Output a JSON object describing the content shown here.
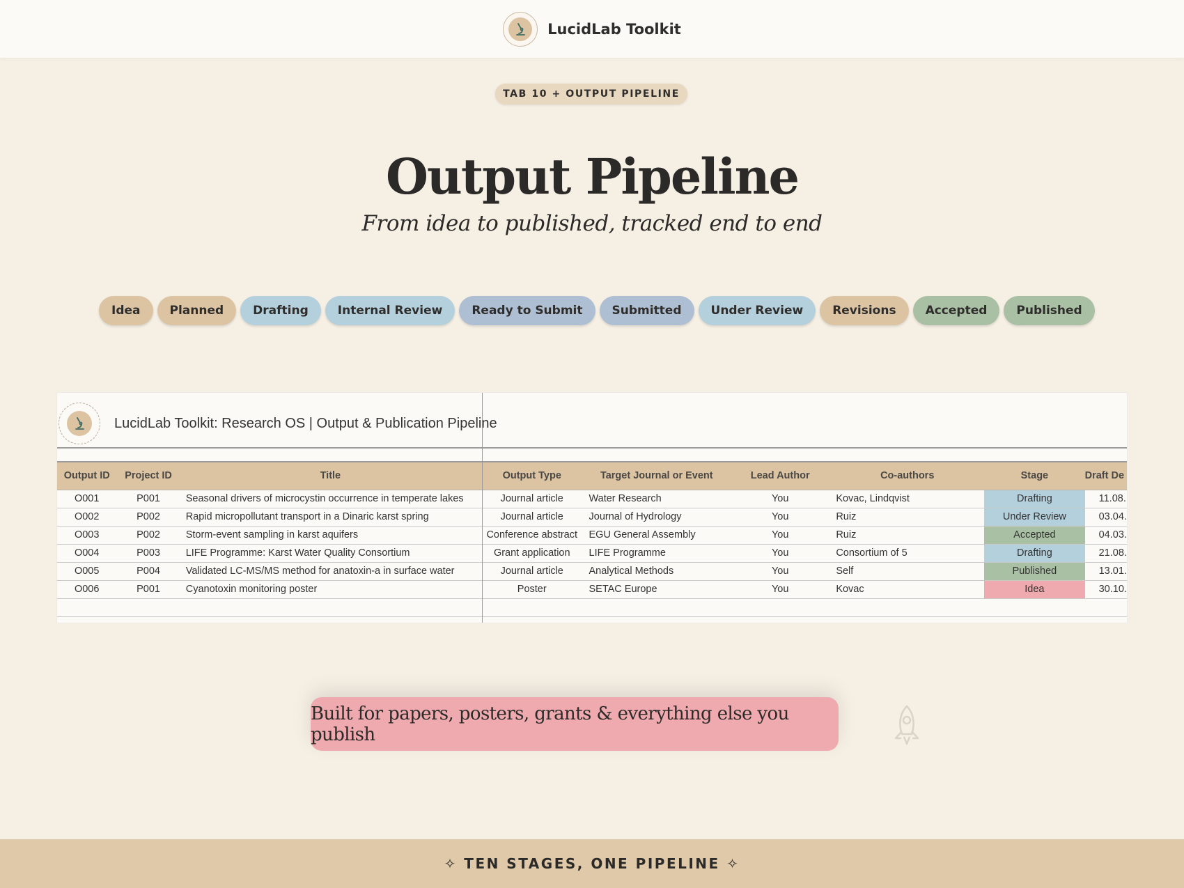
{
  "header": {
    "brand": "LucidLab Toolkit",
    "logo_icon": "microscope-icon"
  },
  "tab_pill": "TAB 10 + OUTPUT PIPELINE",
  "title": "Output Pipeline",
  "subtitle": "From idea to published, tracked end to end",
  "stages": [
    {
      "label": "Idea",
      "color": "#dcc4a2"
    },
    {
      "label": "Planned",
      "color": "#dcc4a2"
    },
    {
      "label": "Drafting",
      "color": "#b4d0dc"
    },
    {
      "label": "Internal Review",
      "color": "#b4d0dc"
    },
    {
      "label": "Ready to Submit",
      "color": "#aebfd4"
    },
    {
      "label": "Submitted",
      "color": "#aebfd4"
    },
    {
      "label": "Under Review",
      "color": "#b4d0dc"
    },
    {
      "label": "Revisions",
      "color": "#dcc4a2"
    },
    {
      "label": "Accepted",
      "color": "#a9c0a4"
    },
    {
      "label": "Published",
      "color": "#a9c0a4"
    }
  ],
  "sheet": {
    "title": "LucidLab Toolkit: Research OS  |  Output & Publication Pipeline",
    "columns": [
      "Output ID",
      "Project ID",
      "Title",
      "Output Type",
      "Target Journal or Event",
      "Lead Author",
      "Co-authors",
      "Stage",
      "Draft De"
    ],
    "rows": [
      {
        "output_id": "O001",
        "project_id": "P001",
        "title": "Seasonal drivers of microcystin occurrence in temperate lakes",
        "type": "Journal article",
        "target": "Water Research",
        "lead": "You",
        "coauthors": "Kovac, Lindqvist",
        "stage": "Drafting",
        "stage_color": "#b4d0dc",
        "draft": "11.08."
      },
      {
        "output_id": "O002",
        "project_id": "P002",
        "title": "Rapid micropollutant transport in a Dinaric karst spring",
        "type": "Journal article",
        "target": "Journal of Hydrology",
        "lead": "You",
        "coauthors": "Ruiz",
        "stage": "Under Review",
        "stage_color": "#b4d0dc",
        "draft": "03.04."
      },
      {
        "output_id": "O003",
        "project_id": "P002",
        "title": "Storm-event sampling in karst aquifers",
        "type": "Conference abstract",
        "target": "EGU General Assembly",
        "lead": "You",
        "coauthors": "Ruiz",
        "stage": "Accepted",
        "stage_color": "#a9c0a4",
        "draft": "04.03."
      },
      {
        "output_id": "O004",
        "project_id": "P003",
        "title": "LIFE Programme: Karst Water Quality Consortium",
        "type": "Grant application",
        "target": "LIFE Programme",
        "lead": "You",
        "coauthors": "Consortium of 5",
        "stage": "Drafting",
        "stage_color": "#b4d0dc",
        "draft": "21.08."
      },
      {
        "output_id": "O005",
        "project_id": "P004",
        "title": "Validated LC-MS/MS method for anatoxin-a in surface water",
        "type": "Journal article",
        "target": "Analytical Methods",
        "lead": "You",
        "coauthors": "Self",
        "stage": "Published",
        "stage_color": "#a9c0a4",
        "draft": "13.01."
      },
      {
        "output_id": "O006",
        "project_id": "P001",
        "title": "Cyanotoxin monitoring poster",
        "type": "Poster",
        "target": "SETAC Europe",
        "lead": "You",
        "coauthors": "Kovac",
        "stage": "Idea",
        "stage_color": "#eeaaae",
        "draft": "30.10."
      }
    ]
  },
  "callout": "Built for papers, posters, grants & everything else you publish",
  "callout_icon": "rocket-icon",
  "footer": "✧ TEN STAGES, ONE PIPELINE ✧"
}
